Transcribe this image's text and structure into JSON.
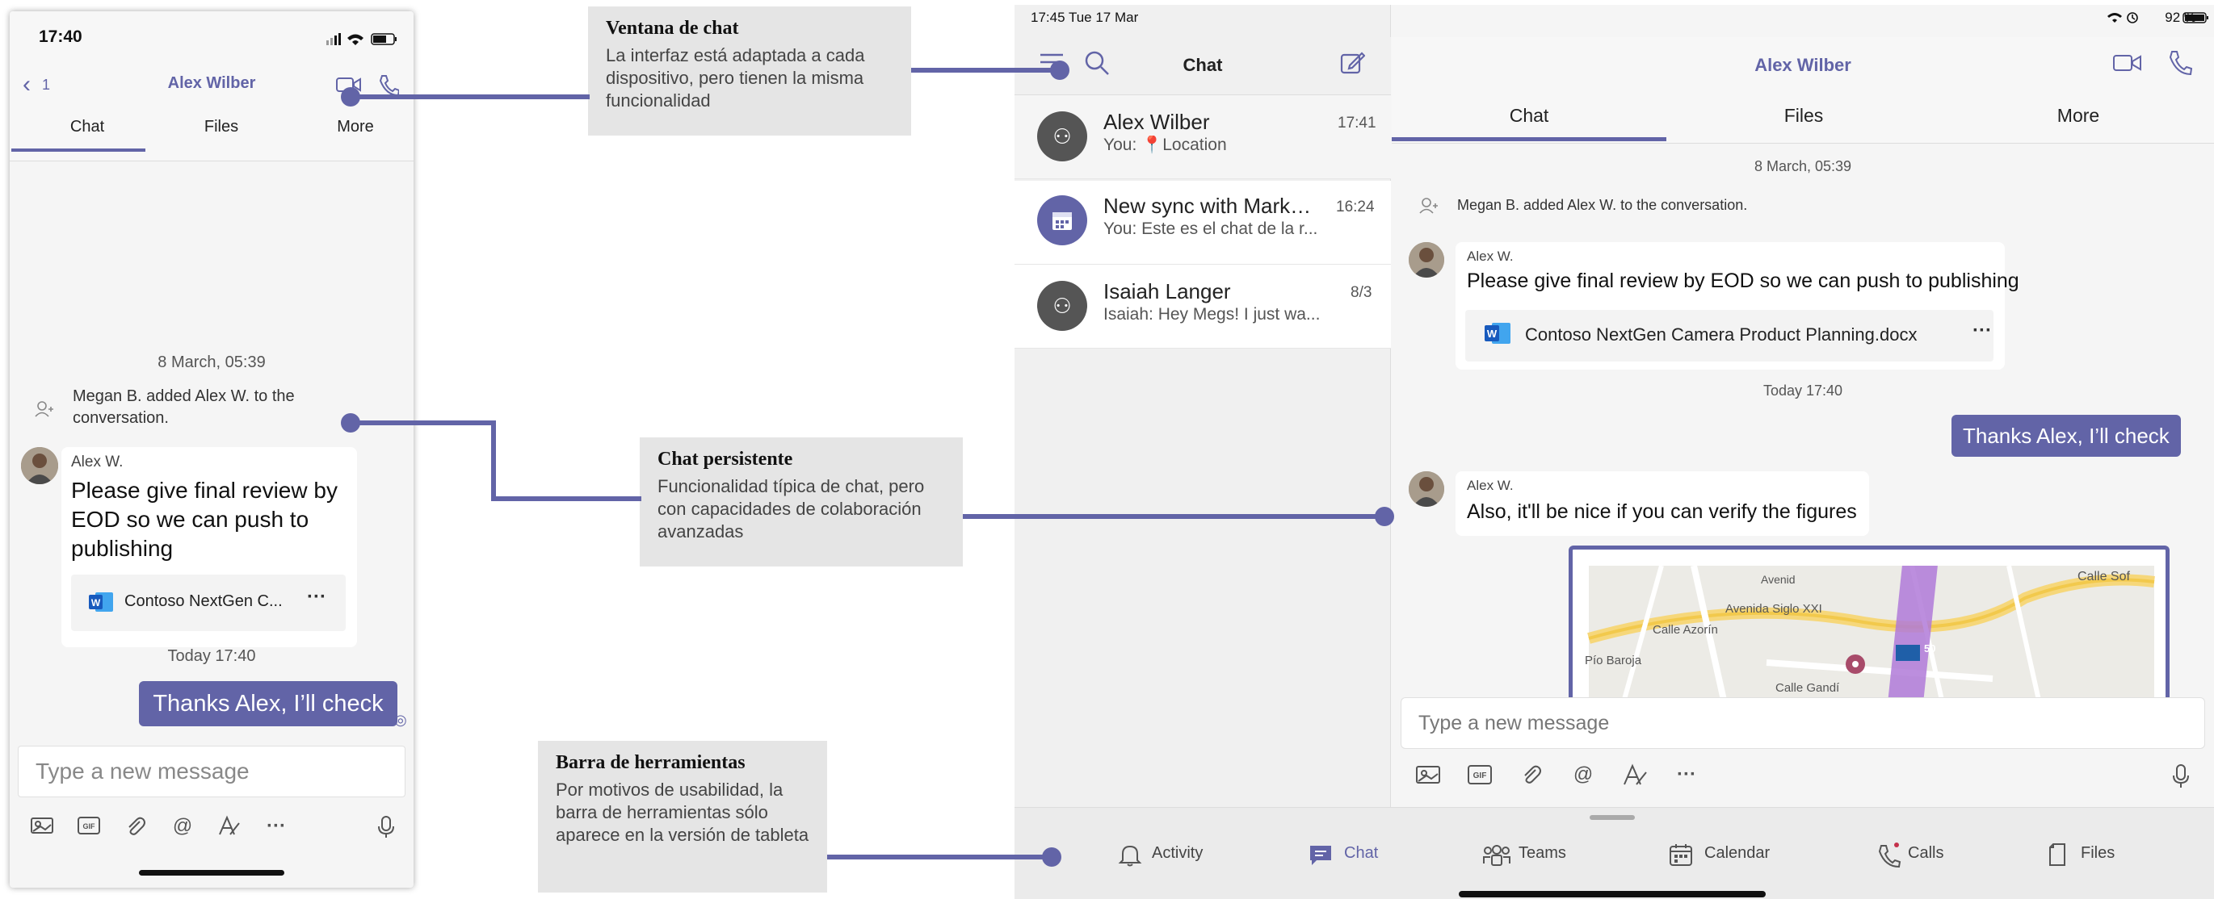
{
  "phone": {
    "status_time": "17:40",
    "back_count": "1",
    "title": "Alex Wilber",
    "tabs": [
      "Chat",
      "Files",
      "More"
    ],
    "date": "8 March, 05:39",
    "system_message": "Megan B. added Alex W. to the conversation.",
    "sender": "Alex W.",
    "message": "Please give final review by EOD so we can push to publishing",
    "file_name": "Contoso NextGen C...",
    "file_more": "···",
    "today": "Today 17:40",
    "my_message": "Thanks Alex, I’ll check",
    "input_placeholder": "Type a new message"
  },
  "tablet": {
    "status_time": "17:45   Tue 17 Mar",
    "status_right": "92 %",
    "list_title": "Chat",
    "chats": [
      {
        "name": "Alex Wilber",
        "time": "17:41",
        "last": "You: 📍Location"
      },
      {
        "name": "New sync with Marketi...",
        "time": "16:24",
        "last": "You: Este es el chat de la r..."
      },
      {
        "name": "Isaiah Langer",
        "time": "8/3",
        "last": "Isaiah: Hey Megs! I just wa..."
      }
    ],
    "chat_title": "Alex Wilber",
    "tabs": [
      "Chat",
      "Files",
      "More"
    ],
    "date": "8 March, 05:39",
    "system_message": "Megan B. added Alex W. to the conversation.",
    "sender1": "Alex W.",
    "message1": "Please give final review by EOD so we can push to publishing",
    "file_name": "Contoso NextGen Camera Product Planning.docx",
    "file_more": "···",
    "today": "Today 17:40",
    "my_message": "Thanks Alex, I’ll check",
    "sender2": "Alex W.",
    "message2": "Also, it'll be nice if you can verify the figures",
    "map_labels": [
      "Calle Sof",
      "Avenida Siglo XXI",
      "Calle Azorín",
      "Pío Baroja",
      "Calle Gandí",
      "Avenid",
      "50"
    ],
    "input_placeholder": "Type a new message",
    "bottom_tabs": [
      "Activity",
      "Chat",
      "Teams",
      "Calendar",
      "Calls",
      "Files"
    ]
  },
  "callouts": {
    "chat_window": {
      "title": "Ventana de chat",
      "body": "La interfaz está adaptada a cada dispositivo, pero tienen la misma funcionalidad"
    },
    "persistent": {
      "title": "Chat persistente",
      "body": "Funcionalidad típica de chat, pero con capacidades de colaboración avanzadas"
    },
    "toolbar": {
      "title": "Barra de herramientas",
      "body": "Por motivos de usabilidad, la barra de herramientas sólo aparece en la versión de tableta"
    }
  },
  "colors": {
    "accent": "#6264a7",
    "callout_bg": "#e5e5e5"
  }
}
